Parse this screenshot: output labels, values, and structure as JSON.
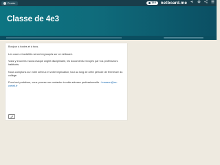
{
  "topbar": {
    "user_name": "Prunier",
    "badge_value": "15:5",
    "brand": "netboard.me",
    "tools": [
      "volume-icon",
      "settings-icon",
      "share-icon",
      "menu-icon"
    ]
  },
  "page": {
    "title": "Classe de 4e3"
  },
  "card": {
    "paragraphs": [
      "Bonjour à toutes et à tous.",
      "Les cours et activités seront regroupés sur ce netboard.",
      "Vous y trouverez sous chaque onglet disciplinaire, les documents envoyés par vos professeurs habituels.",
      "Nous comptons sur votre sérieux et votre implication, tout au long de cette période de fermeture du collège."
    ],
    "contact_text": "Pour tout problème, vous pouvez me contacter à cette adresse professionnelle : ",
    "contact_email": "lmasson@ac-creteil.fr"
  },
  "colors": {
    "topbar": "#193d4a",
    "hero_start": "#0d7582",
    "hero_end": "#0b4f63",
    "background": "#eeeae0",
    "link": "#1a6ab0"
  }
}
